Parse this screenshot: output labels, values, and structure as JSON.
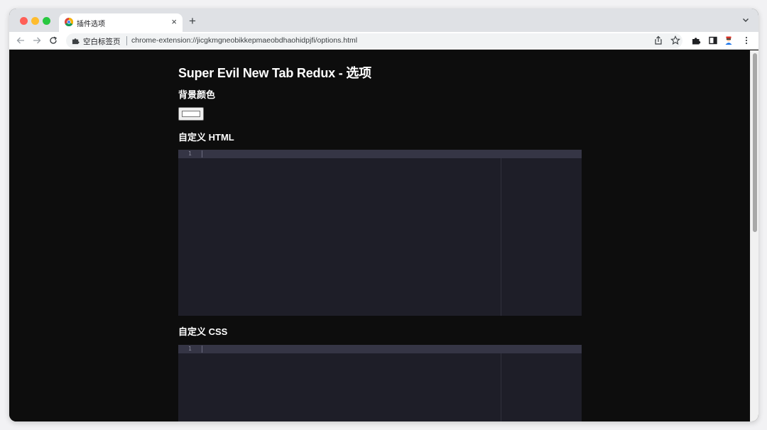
{
  "browser": {
    "tab": {
      "title": "插件选项",
      "close_glyph": "×"
    },
    "new_tab_glyph": "+",
    "omnibox": {
      "site_label": "空白标签页",
      "url": "chrome-extension://jicgkmgneobikkepmaeobdhaohidpjfi/options.html"
    }
  },
  "page": {
    "title": "Super Evil New Tab Redux - 选项",
    "background_color": {
      "label": "背景颜色",
      "value": "#ffffff"
    },
    "custom_html": {
      "label": "自定义 HTML",
      "line_number": "1"
    },
    "custom_css": {
      "label": "自定义 CSS",
      "line_number": "1"
    }
  },
  "colors": {
    "page_bg": "#0d0d0d",
    "editor_bg": "#1e1e28",
    "editor_active_line": "#353545"
  }
}
